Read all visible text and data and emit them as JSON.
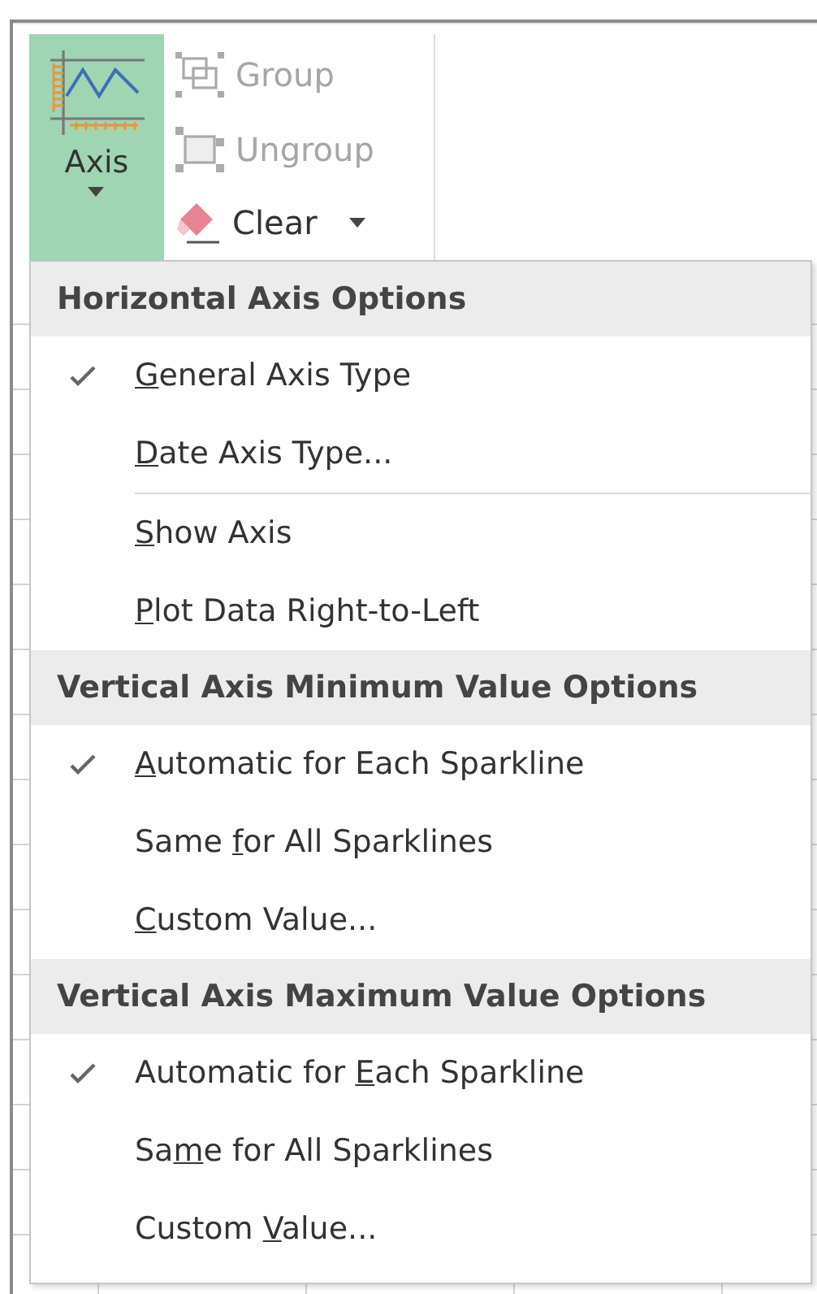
{
  "ribbon": {
    "axis_button": {
      "label": "Axis",
      "selected": true
    },
    "commands": [
      {
        "kind": "group",
        "label": "Group",
        "disabled": true
      },
      {
        "kind": "ungroup",
        "label": "Ungroup",
        "disabled": true
      },
      {
        "kind": "clear",
        "label": "Clear",
        "disabled": false,
        "has_dropdown": true
      }
    ]
  },
  "menu": {
    "sections": [
      {
        "heading": "Horizontal Axis Options",
        "items": [
          {
            "key": "G",
            "post": "eneral Axis Type",
            "checked": true,
            "separator_after": false
          },
          {
            "key": "D",
            "post": "ate Axis Type...",
            "checked": false,
            "separator_after": true
          },
          {
            "key": "S",
            "post": "how Axis",
            "checked": false,
            "separator_after": false
          },
          {
            "key": "P",
            "post": "lot Data Right-to-Left",
            "checked": false,
            "separator_after": false
          }
        ]
      },
      {
        "heading": "Vertical Axis Minimum Value Options",
        "items": [
          {
            "key": "A",
            "post": "utomatic for Each Sparkline",
            "checked": true,
            "separator_after": false
          },
          {
            "pre": "Same ",
            "key": "f",
            "post": "or All Sparklines",
            "checked": false,
            "separator_after": false
          },
          {
            "key": "C",
            "post": "ustom Value...",
            "checked": false,
            "separator_after": false
          }
        ]
      },
      {
        "heading": "Vertical Axis Maximum Value Options",
        "items": [
          {
            "pre": "Automatic for ",
            "key": "E",
            "post": "ach Sparkline",
            "checked": true,
            "separator_after": false
          },
          {
            "pre": "Sa",
            "key": "m",
            "post": "e for All Sparklines",
            "checked": false,
            "separator_after": false
          },
          {
            "pre": "Custom ",
            "key": "V",
            "post": "alue...",
            "checked": false,
            "separator_after": false
          }
        ]
      }
    ]
  }
}
